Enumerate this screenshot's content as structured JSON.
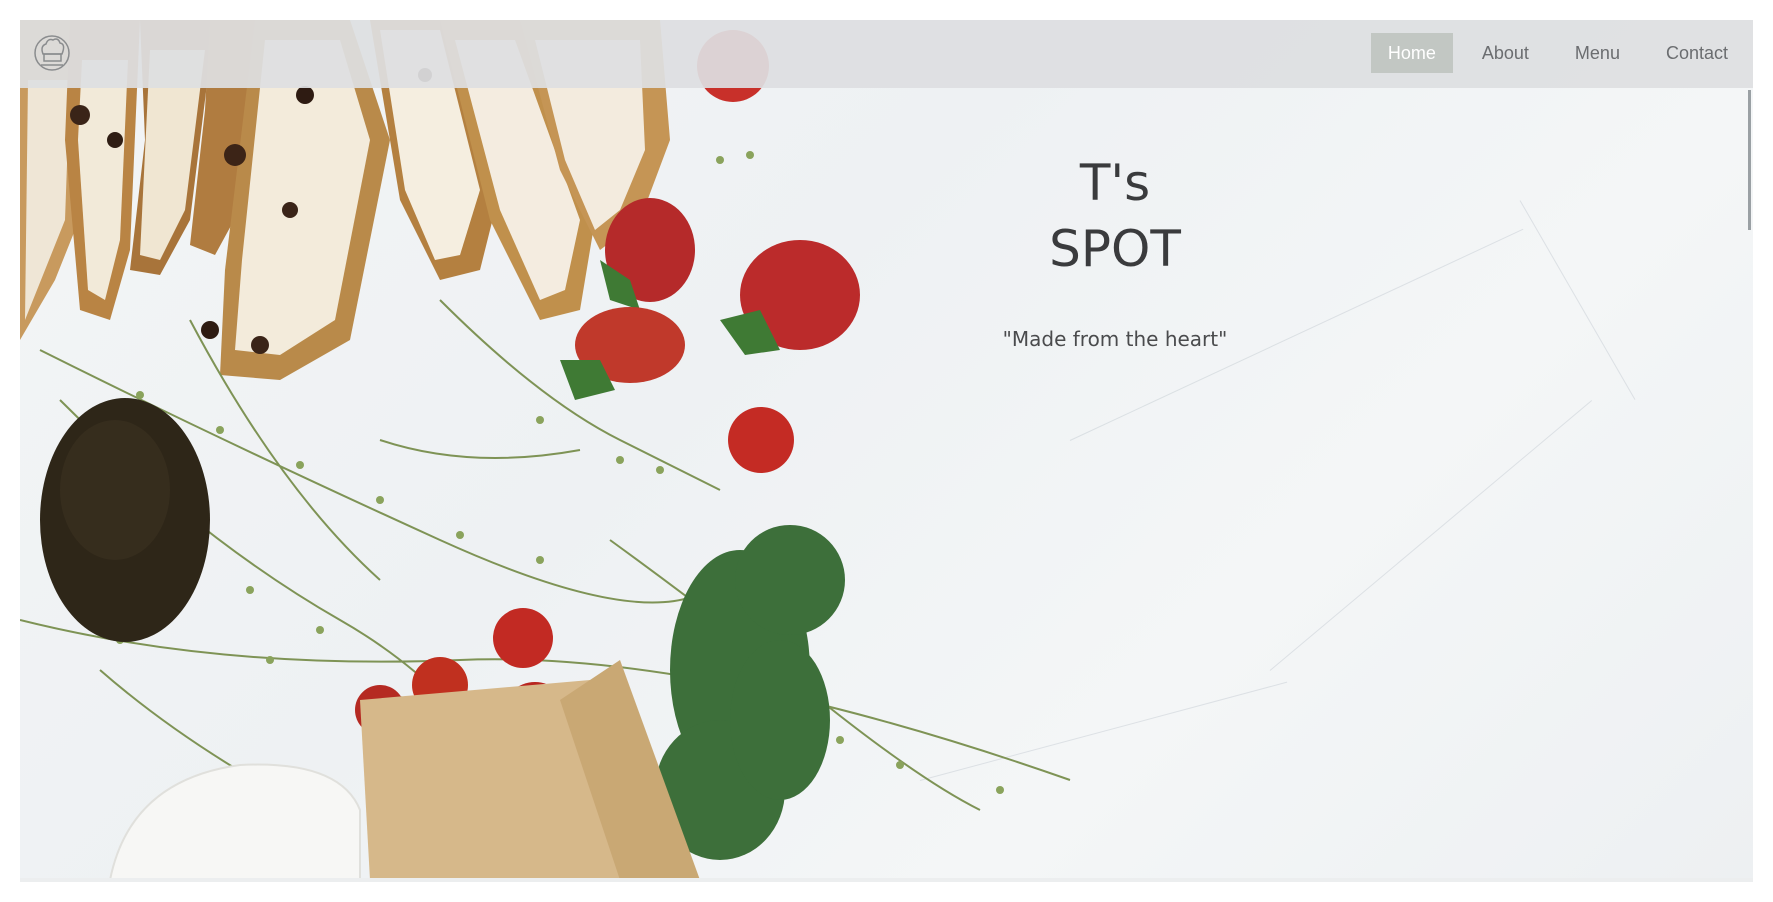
{
  "site": {
    "logo_icon": "chef-hat-icon",
    "title_line1": "T's",
    "title_line2": "SPOT",
    "tagline": "\"Made from the heart\""
  },
  "nav": {
    "items": [
      {
        "label": "Home",
        "active": true
      },
      {
        "label": "About",
        "active": false
      },
      {
        "label": "Menu",
        "active": false
      },
      {
        "label": "Contact",
        "active": false
      }
    ]
  },
  "colors": {
    "nav_background": "#dedfe1",
    "nav_active": "#c2c7c3",
    "nav_text": "#6b6d70",
    "title_text": "#3a3b3d"
  }
}
